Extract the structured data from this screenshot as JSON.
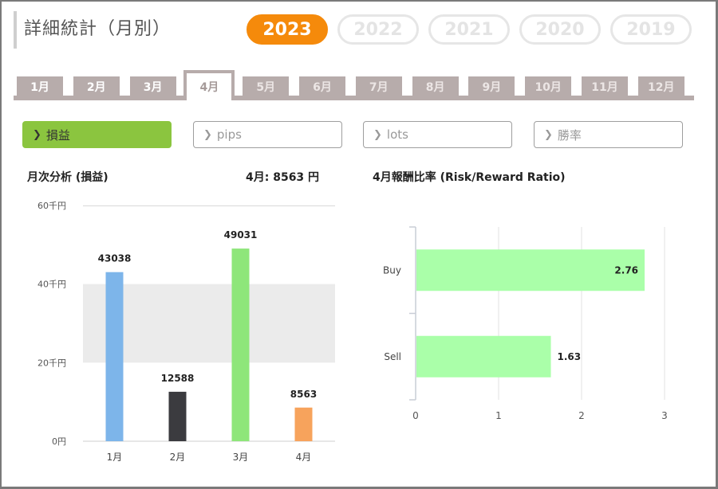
{
  "title": "詳細統計（月別）",
  "years": [
    "2023",
    "2022",
    "2021",
    "2020",
    "2019"
  ],
  "selected_year": "2023",
  "months": [
    "1月",
    "2月",
    "3月",
    "4月",
    "5月",
    "6月",
    "7月",
    "8月",
    "9月",
    "10月",
    "11月",
    "12月"
  ],
  "selected_month": "4月",
  "metrics": [
    "損益",
    "pips",
    "lots",
    "勝率"
  ],
  "selected_metric": "損益",
  "left_panel": {
    "heading": "月次分析 (損益)",
    "summary": "4月:  8563 円"
  },
  "right_panel": {
    "heading": "4月報酬比率 (Risk/Reward Ratio)"
  },
  "colors": {
    "accent": "#f58a0b",
    "metric_active": "#8bc53f",
    "tab": "#b7acab"
  },
  "chart_data": [
    {
      "type": "bar",
      "categories": [
        "1月",
        "2月",
        "3月",
        "4月"
      ],
      "values": [
        43038,
        12588,
        49031,
        8563
      ],
      "bar_colors": [
        "#7db5ea",
        "#3b3b3f",
        "#8ee67a",
        "#f7a35c"
      ],
      "ytick_labels": [
        "0円",
        "20千円",
        "40千円",
        "60千円"
      ],
      "yticks": [
        0,
        20000,
        40000,
        60000
      ],
      "ylim": [
        0,
        60000
      ],
      "data_labels": true,
      "alternating_bands": true
    },
    {
      "type": "bar",
      "orientation": "horizontal",
      "categories": [
        "Buy",
        "Sell"
      ],
      "values": [
        2.76,
        1.63
      ],
      "color": "#aaffa9",
      "xticks": [
        0,
        1,
        2,
        3
      ],
      "xlim": [
        0,
        3
      ],
      "data_labels": true,
      "grid": true
    }
  ]
}
